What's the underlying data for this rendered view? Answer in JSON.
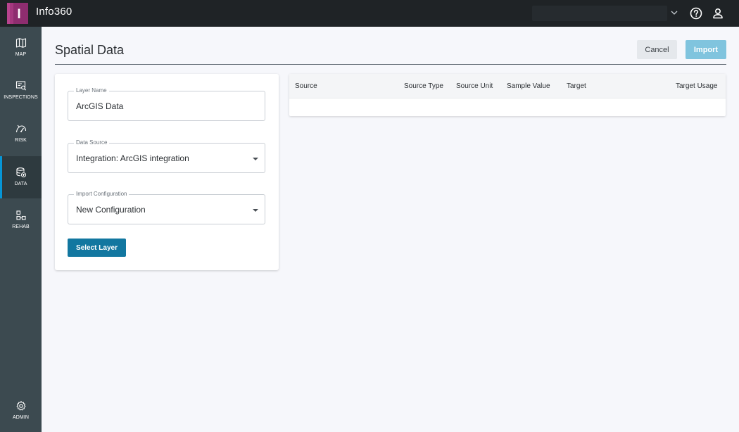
{
  "app": {
    "title": "Info360",
    "logo_letter": "I",
    "brand_color": "#8e2d6f"
  },
  "sidebar": {
    "items": [
      {
        "label": "MAP",
        "icon": "map-icon"
      },
      {
        "label": "INSPECTIONS",
        "icon": "inspections-icon"
      },
      {
        "label": "RISK",
        "icon": "risk-icon"
      },
      {
        "label": "DATA",
        "icon": "data-icon",
        "active": true
      },
      {
        "label": "REHAB",
        "icon": "rehab-icon"
      },
      {
        "label": "ADMIN",
        "icon": "gear-icon"
      }
    ]
  },
  "header": {
    "title": "Spatial Data",
    "cancel_label": "Cancel",
    "import_label": "Import"
  },
  "form": {
    "layer_name": {
      "label": "Layer Name",
      "value": "ArcGIS Data"
    },
    "data_source": {
      "label": "Data Source",
      "value": "Integration: ArcGIS integration"
    },
    "import_config": {
      "label": "Import Configuration",
      "value": "New Configuration"
    },
    "select_layer_label": "Select Layer"
  },
  "table": {
    "columns": [
      "Source",
      "Source Type",
      "Source Unit",
      "Sample Value",
      "Target",
      "Target Usage"
    ],
    "rows": []
  },
  "colors": {
    "accent": "#0696d7",
    "primary_button": "#1277a0",
    "disabled_button": "#80c4de"
  }
}
